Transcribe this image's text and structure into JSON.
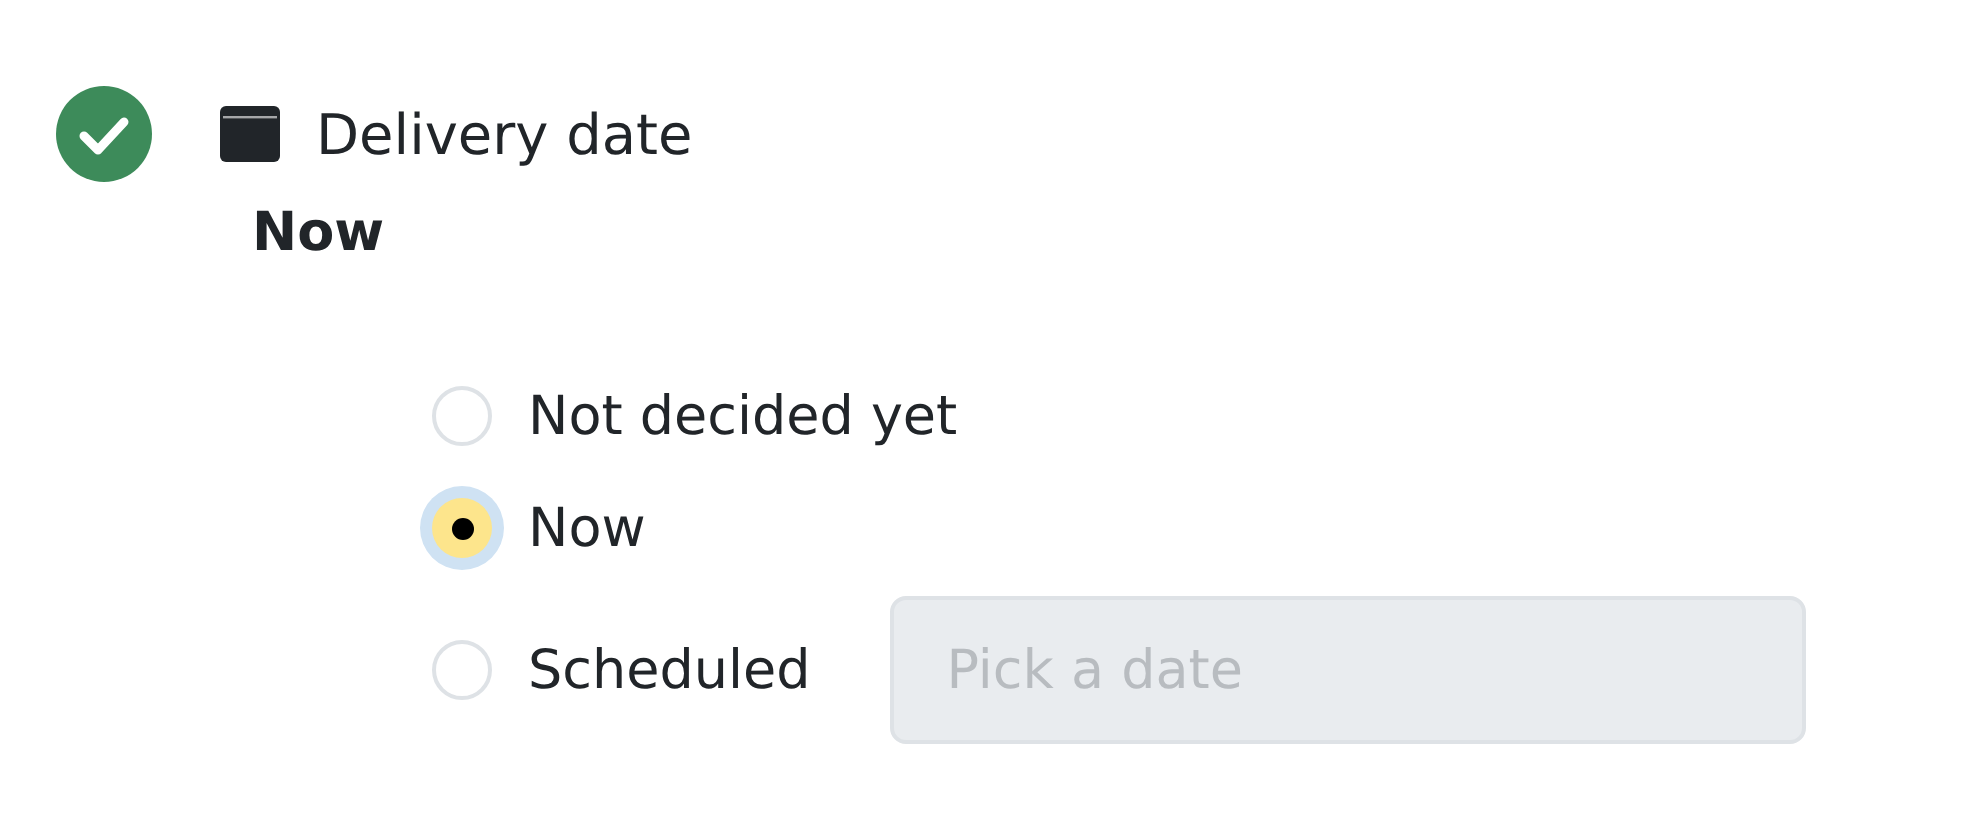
{
  "step": {
    "completed": true,
    "title": "Delivery date",
    "summary": "Now"
  },
  "options": [
    {
      "label": "Not decided yet",
      "selected": false
    },
    {
      "label": "Now",
      "selected": true
    },
    {
      "label": "Scheduled",
      "selected": false,
      "date_field": {
        "placeholder": "Pick a date",
        "disabled": true
      }
    }
  ]
}
